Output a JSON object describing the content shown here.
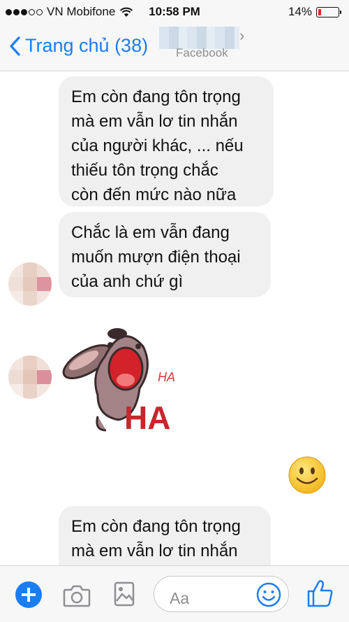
{
  "status_bar": {
    "carrier": "VN Mobifone",
    "time": "10:58 PM",
    "battery_percent": "14%",
    "battery_level": 0.14,
    "battery_color": "#e5262b",
    "signal_dots_filled": 3,
    "signal_dots_total": 5,
    "icons": [
      "wifi-icon",
      "battery-icon"
    ]
  },
  "nav": {
    "back_label": "Trang chủ (38)",
    "subtitle": "Facebook",
    "accent_color": "#1a7df2"
  },
  "messages": [
    {
      "type": "text",
      "lines": [
        "Em còn đang tôn trọng",
        "mà  em vẫn lơ tin nhắn",
        "của người khác, ... nếu",
        "thiếu tôn trọng chắc",
        "còn đến mức nào nữa"
      ]
    },
    {
      "type": "text",
      "lines": [
        "Chắc là em vẫn đang",
        "muốn mượn điện thoại",
        "của anh chứ gì"
      ]
    },
    {
      "type": "sticker",
      "name": "laughing-dog-sticker",
      "text_small": "HA",
      "text_big": "HA"
    },
    {
      "type": "emoji",
      "name": "smiley-emoji"
    },
    {
      "type": "text",
      "lines": [
        "Em còn đang tôn trọng",
        "mà  em vẫn lơ tin nhắn"
      ]
    }
  ],
  "composer": {
    "placeholder": "Aa",
    "icons": [
      "plus-icon",
      "camera-icon",
      "gallery-icon",
      "emoji-icon",
      "like-icon"
    ]
  }
}
